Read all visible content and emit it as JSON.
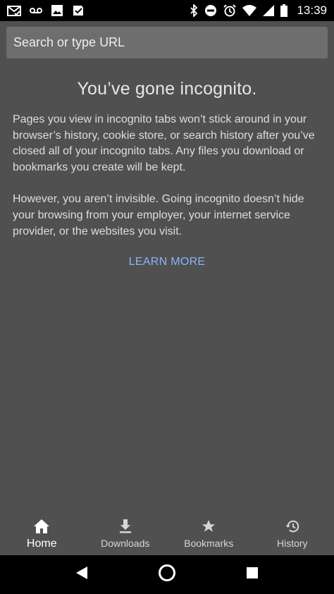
{
  "status_bar": {
    "time": "13:39",
    "left_icons": [
      "mail-check-icon",
      "voicemail-icon",
      "image-icon",
      "checklist-icon"
    ],
    "right_icons": [
      "bluetooth-icon",
      "do-not-disturb-icon",
      "alarm-icon",
      "wifi-icon",
      "cell-signal-icon",
      "battery-icon"
    ]
  },
  "omnibox": {
    "placeholder": "Search or type URL",
    "value": ""
  },
  "incognito": {
    "title": "You’ve gone incognito.",
    "paragraph_1": "Pages you view in incognito tabs won’t stick around in your browser’s history, cookie store, or search history after you’ve closed all of your incognito tabs. Any files you download or bookmarks you create will be kept.",
    "paragraph_2": "However, you aren’t invisible. Going incognito doesn’t hide your browsing from your employer, your internet service provider, or the websites you visit.",
    "learn_more": "LEARN MORE",
    "link_color": "#8ab4f8"
  },
  "bottom_nav": {
    "items": [
      {
        "label": "Home",
        "icon": "home-icon",
        "active": true
      },
      {
        "label": "Downloads",
        "icon": "download-icon",
        "active": false
      },
      {
        "label": "Bookmarks",
        "icon": "star-icon",
        "active": false
      },
      {
        "label": "History",
        "icon": "history-icon",
        "active": false
      }
    ]
  },
  "system_nav": {
    "buttons": [
      "back-icon",
      "home-circle-icon",
      "recents-icon"
    ]
  },
  "colors": {
    "background": "#505050",
    "omnibox": "#6e6e6e",
    "system_bars": "#000000"
  }
}
